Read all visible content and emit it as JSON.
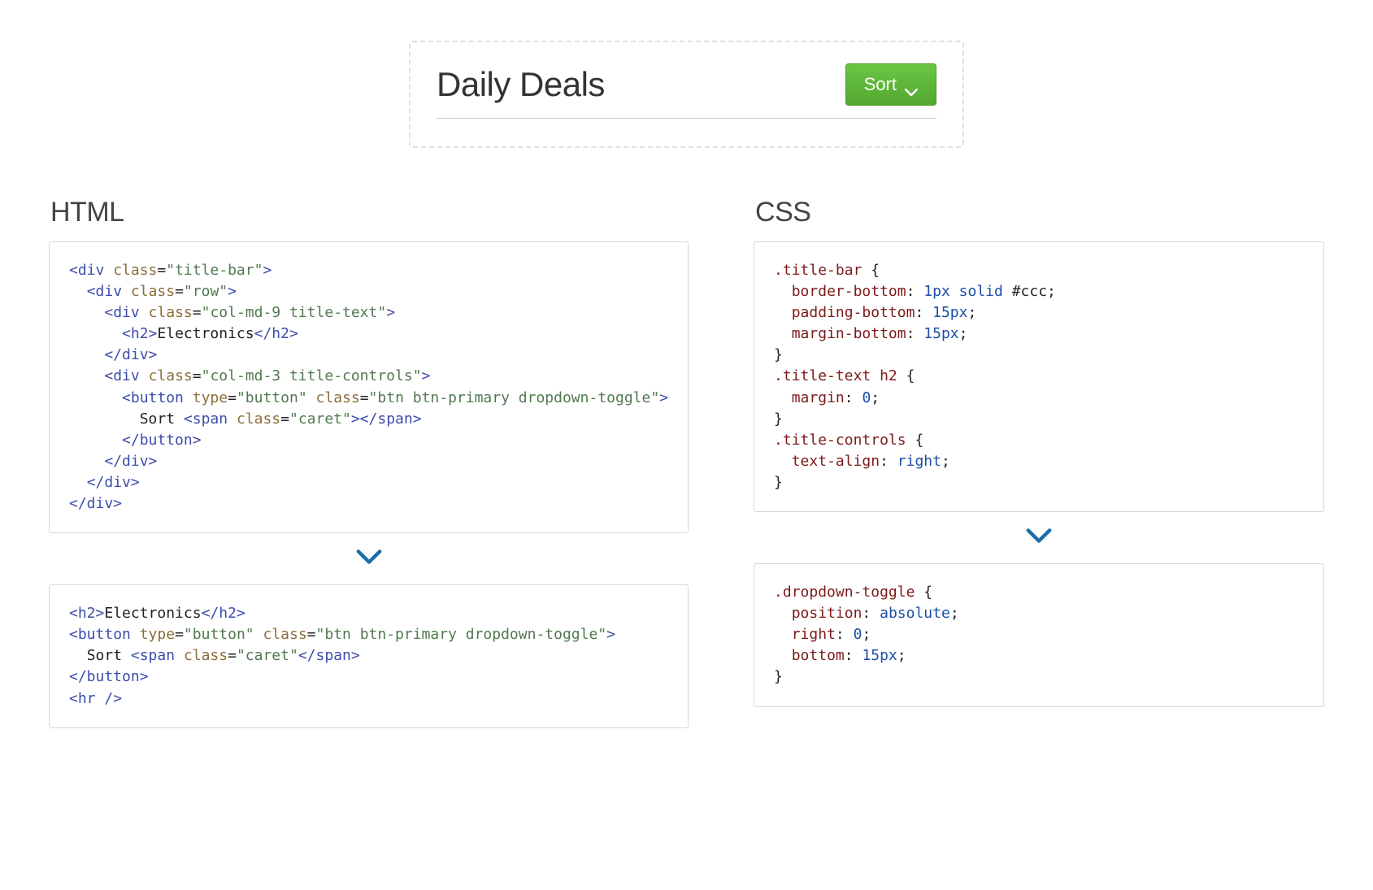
{
  "preview": {
    "title": "Daily Deals",
    "sort_button_label": "Sort"
  },
  "columns": {
    "html_heading": "HTML",
    "css_heading": "CSS"
  },
  "html_example_1": {
    "line1_tag": "div",
    "line1_class": "title-bar",
    "line2_tag": "div",
    "line2_class": "row",
    "line3_tag": "div",
    "line3_class": "col-md-9 title-text",
    "h2_text": "Electronics",
    "line4_tag": "div",
    "line4_class": "col-md-3 title-controls",
    "button_tag": "button",
    "button_type_attr": "type",
    "button_type_val": "button",
    "button_class": "btn btn-primary dropdown-toggle",
    "button_text": "Sort ",
    "caret_tag": "span",
    "caret_class": "caret"
  },
  "html_example_2": {
    "h2_text": "Electronics",
    "button_tag": "button",
    "button_type_attr": "type",
    "button_type_val": "button",
    "button_class": "btn btn-primary dropdown-toggle",
    "button_text": "Sort ",
    "caret_tag": "span",
    "caret_class": "caret",
    "hr_tag": "hr"
  },
  "css_example_1": {
    "s1_selector": ".title-bar",
    "s1_p1_prop": "border-bottom",
    "s1_p1_val_num": "1px",
    "s1_p1_val_kw": "solid",
    "s1_p1_val_hex": "#ccc",
    "s1_p2_prop": "padding-bottom",
    "s1_p2_val": "15px",
    "s1_p3_prop": "margin-bottom",
    "s1_p3_val": "15px",
    "s2_selector": ".title-text h2",
    "s2_p1_prop": "margin",
    "s2_p1_val": "0",
    "s3_selector": ".title-controls",
    "s3_p1_prop": "text-align",
    "s3_p1_val": "right"
  },
  "css_example_2": {
    "selector": ".dropdown-toggle",
    "p1_prop": "position",
    "p1_val": "absolute",
    "p2_prop": "right",
    "p2_val": "0",
    "p3_prop": "bottom",
    "p3_val": "15px"
  }
}
